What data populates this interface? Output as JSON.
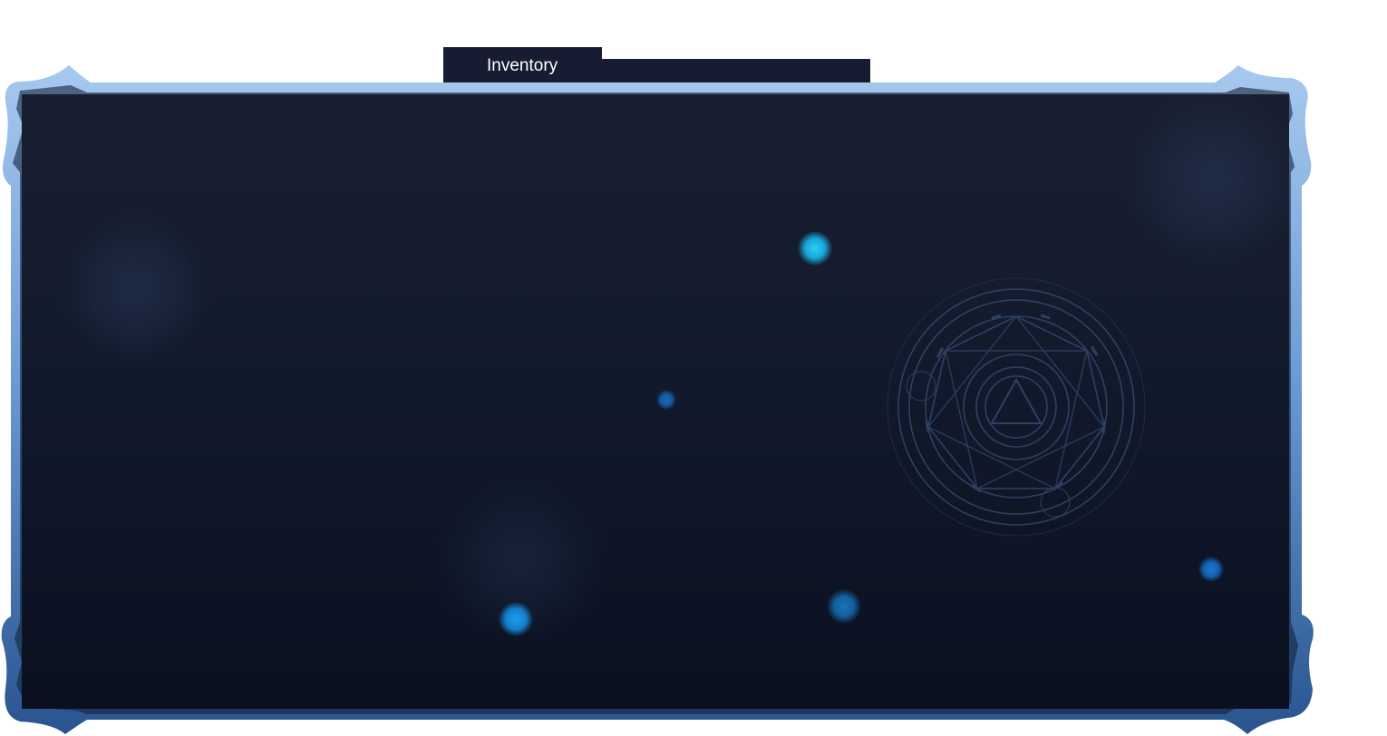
{
  "inventory": {
    "tab_label": "Inventory"
  },
  "colors": {
    "tab_bg": "#181c33",
    "panel_top": "#191f30",
    "panel_bottom": "#0a1020",
    "frame_light": "#9ec3ec",
    "frame_dark": "#2c5a98",
    "orb_cyan": "#1fb8e6",
    "orb_blue": "#1278c8"
  },
  "decorations": {
    "sigil_icon": "magic-circle-icon",
    "orb_icon": "glow-orb-icon"
  }
}
